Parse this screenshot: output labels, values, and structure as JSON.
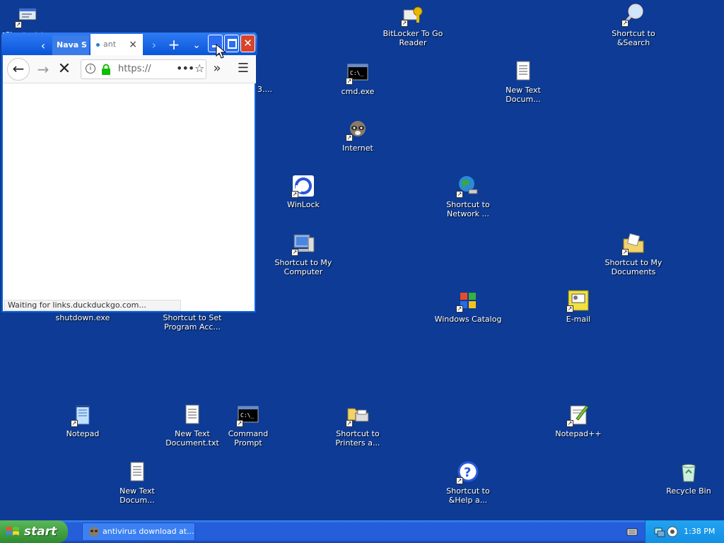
{
  "desktop": {
    "icons": [
      {
        "label": "Shortcut to",
        "icon": "shortcut-run-icon"
      },
      {
        "label": "BitLocker To Go Reader",
        "icon": "bitlocker-icon"
      },
      {
        "label": "Shortcut to &Search",
        "icon": "search-magnifier-icon"
      },
      {
        "label": "cmd.exe",
        "icon": "cmd-icon"
      },
      {
        "label": "New Text Docum...",
        "icon": "text-document-icon"
      },
      {
        "label": "Internet",
        "icon": "raccoon-browser-icon"
      },
      {
        "label": "WinLock",
        "icon": "winlock-icon"
      },
      {
        "label": "Shortcut to Network ...",
        "icon": "network-globe-icon"
      },
      {
        "label": "Shortcut to My Computer",
        "icon": "my-computer-icon"
      },
      {
        "label": "Shortcut to My Documents",
        "icon": "my-documents-icon"
      },
      {
        "label": "shutdown.exe",
        "icon": "shutdown-icon"
      },
      {
        "label": "Shortcut to Set Program Acc...",
        "icon": "program-access-icon"
      },
      {
        "label": "Windows Catalog",
        "icon": "windows-catalog-icon"
      },
      {
        "label": "E-mail",
        "icon": "email-icon"
      },
      {
        "label": "Notepad",
        "icon": "notepad-icon"
      },
      {
        "label": "New Text Document.txt",
        "icon": "text-document-icon"
      },
      {
        "label": "Command Prompt",
        "icon": "cmd-icon"
      },
      {
        "label": "Shortcut to Printers a...",
        "icon": "printer-icon"
      },
      {
        "label": "Notepad++",
        "icon": "notepadpp-icon"
      },
      {
        "label": "New Text Docum...",
        "icon": "text-document-icon"
      },
      {
        "label": "Shortcut to &Help a...",
        "icon": "help-icon"
      },
      {
        "label": "Recycle Bin",
        "icon": "recycle-bin-icon"
      }
    ],
    "partial_label": "3...."
  },
  "browser": {
    "tabs": [
      {
        "label": "Nava S"
      },
      {
        "label": "ant"
      }
    ],
    "url": "https://",
    "status": "Waiting for links.duckduckgo.com..."
  },
  "taskbar": {
    "start_label": "start",
    "task_label": "antivirus download at...",
    "clock": "1:38 PM"
  },
  "colors": {
    "desktop": "#0d3b95",
    "taskbar": "#245edb",
    "start": "#3c9a3c",
    "tray": "#1a9aec"
  }
}
